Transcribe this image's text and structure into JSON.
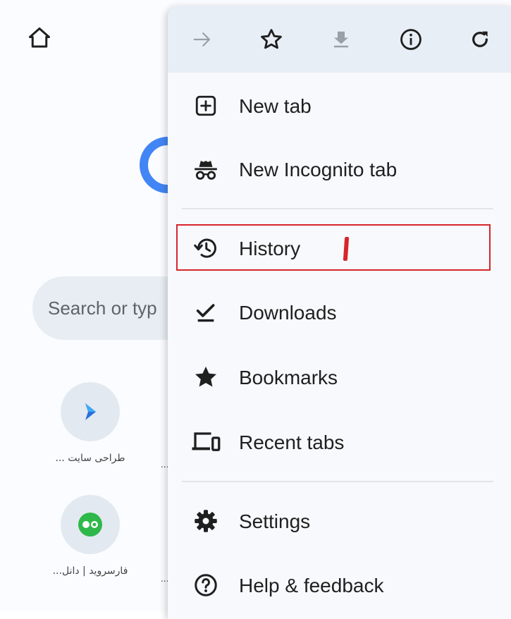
{
  "colors": {
    "menu_bg": "#f7f9fd",
    "toolbar_bg": "#e7eef6",
    "highlight": "#d6262b",
    "search_bg": "#e8edf3",
    "google_blue": "#4285f4"
  },
  "background": {
    "search_placeholder": "Search or typ",
    "tiles": [
      {
        "label": "طراحی سایت ...",
        "icon": "arrow-logo-icon"
      },
      {
        "label": "فارسروید | دانل...",
        "icon": "green-circle-logo-icon"
      }
    ],
    "tile_ellipsis": [
      "...",
      "..."
    ]
  },
  "toolbar": {
    "buttons": [
      {
        "name": "forward",
        "icon": "forward-arrow-icon",
        "enabled": false
      },
      {
        "name": "bookmark",
        "icon": "star-outline-icon",
        "enabled": true
      },
      {
        "name": "download",
        "icon": "download-icon",
        "enabled": false
      },
      {
        "name": "page-info",
        "icon": "info-icon",
        "enabled": true
      },
      {
        "name": "reload",
        "icon": "reload-icon",
        "enabled": true
      }
    ]
  },
  "menu": {
    "items": [
      {
        "label": "New tab",
        "icon": "new-tab-icon"
      },
      {
        "label": "New Incognito tab",
        "icon": "incognito-icon"
      },
      {
        "label": "History",
        "icon": "history-icon"
      },
      {
        "label": "Downloads",
        "icon": "downloads-check-icon"
      },
      {
        "label": "Bookmarks",
        "icon": "star-filled-icon"
      },
      {
        "label": "Recent tabs",
        "icon": "devices-icon"
      },
      {
        "label": "Settings",
        "icon": "gear-icon"
      },
      {
        "label": "Help & feedback",
        "icon": "help-icon"
      }
    ]
  },
  "annotation": {
    "label": "١",
    "target": "History"
  }
}
